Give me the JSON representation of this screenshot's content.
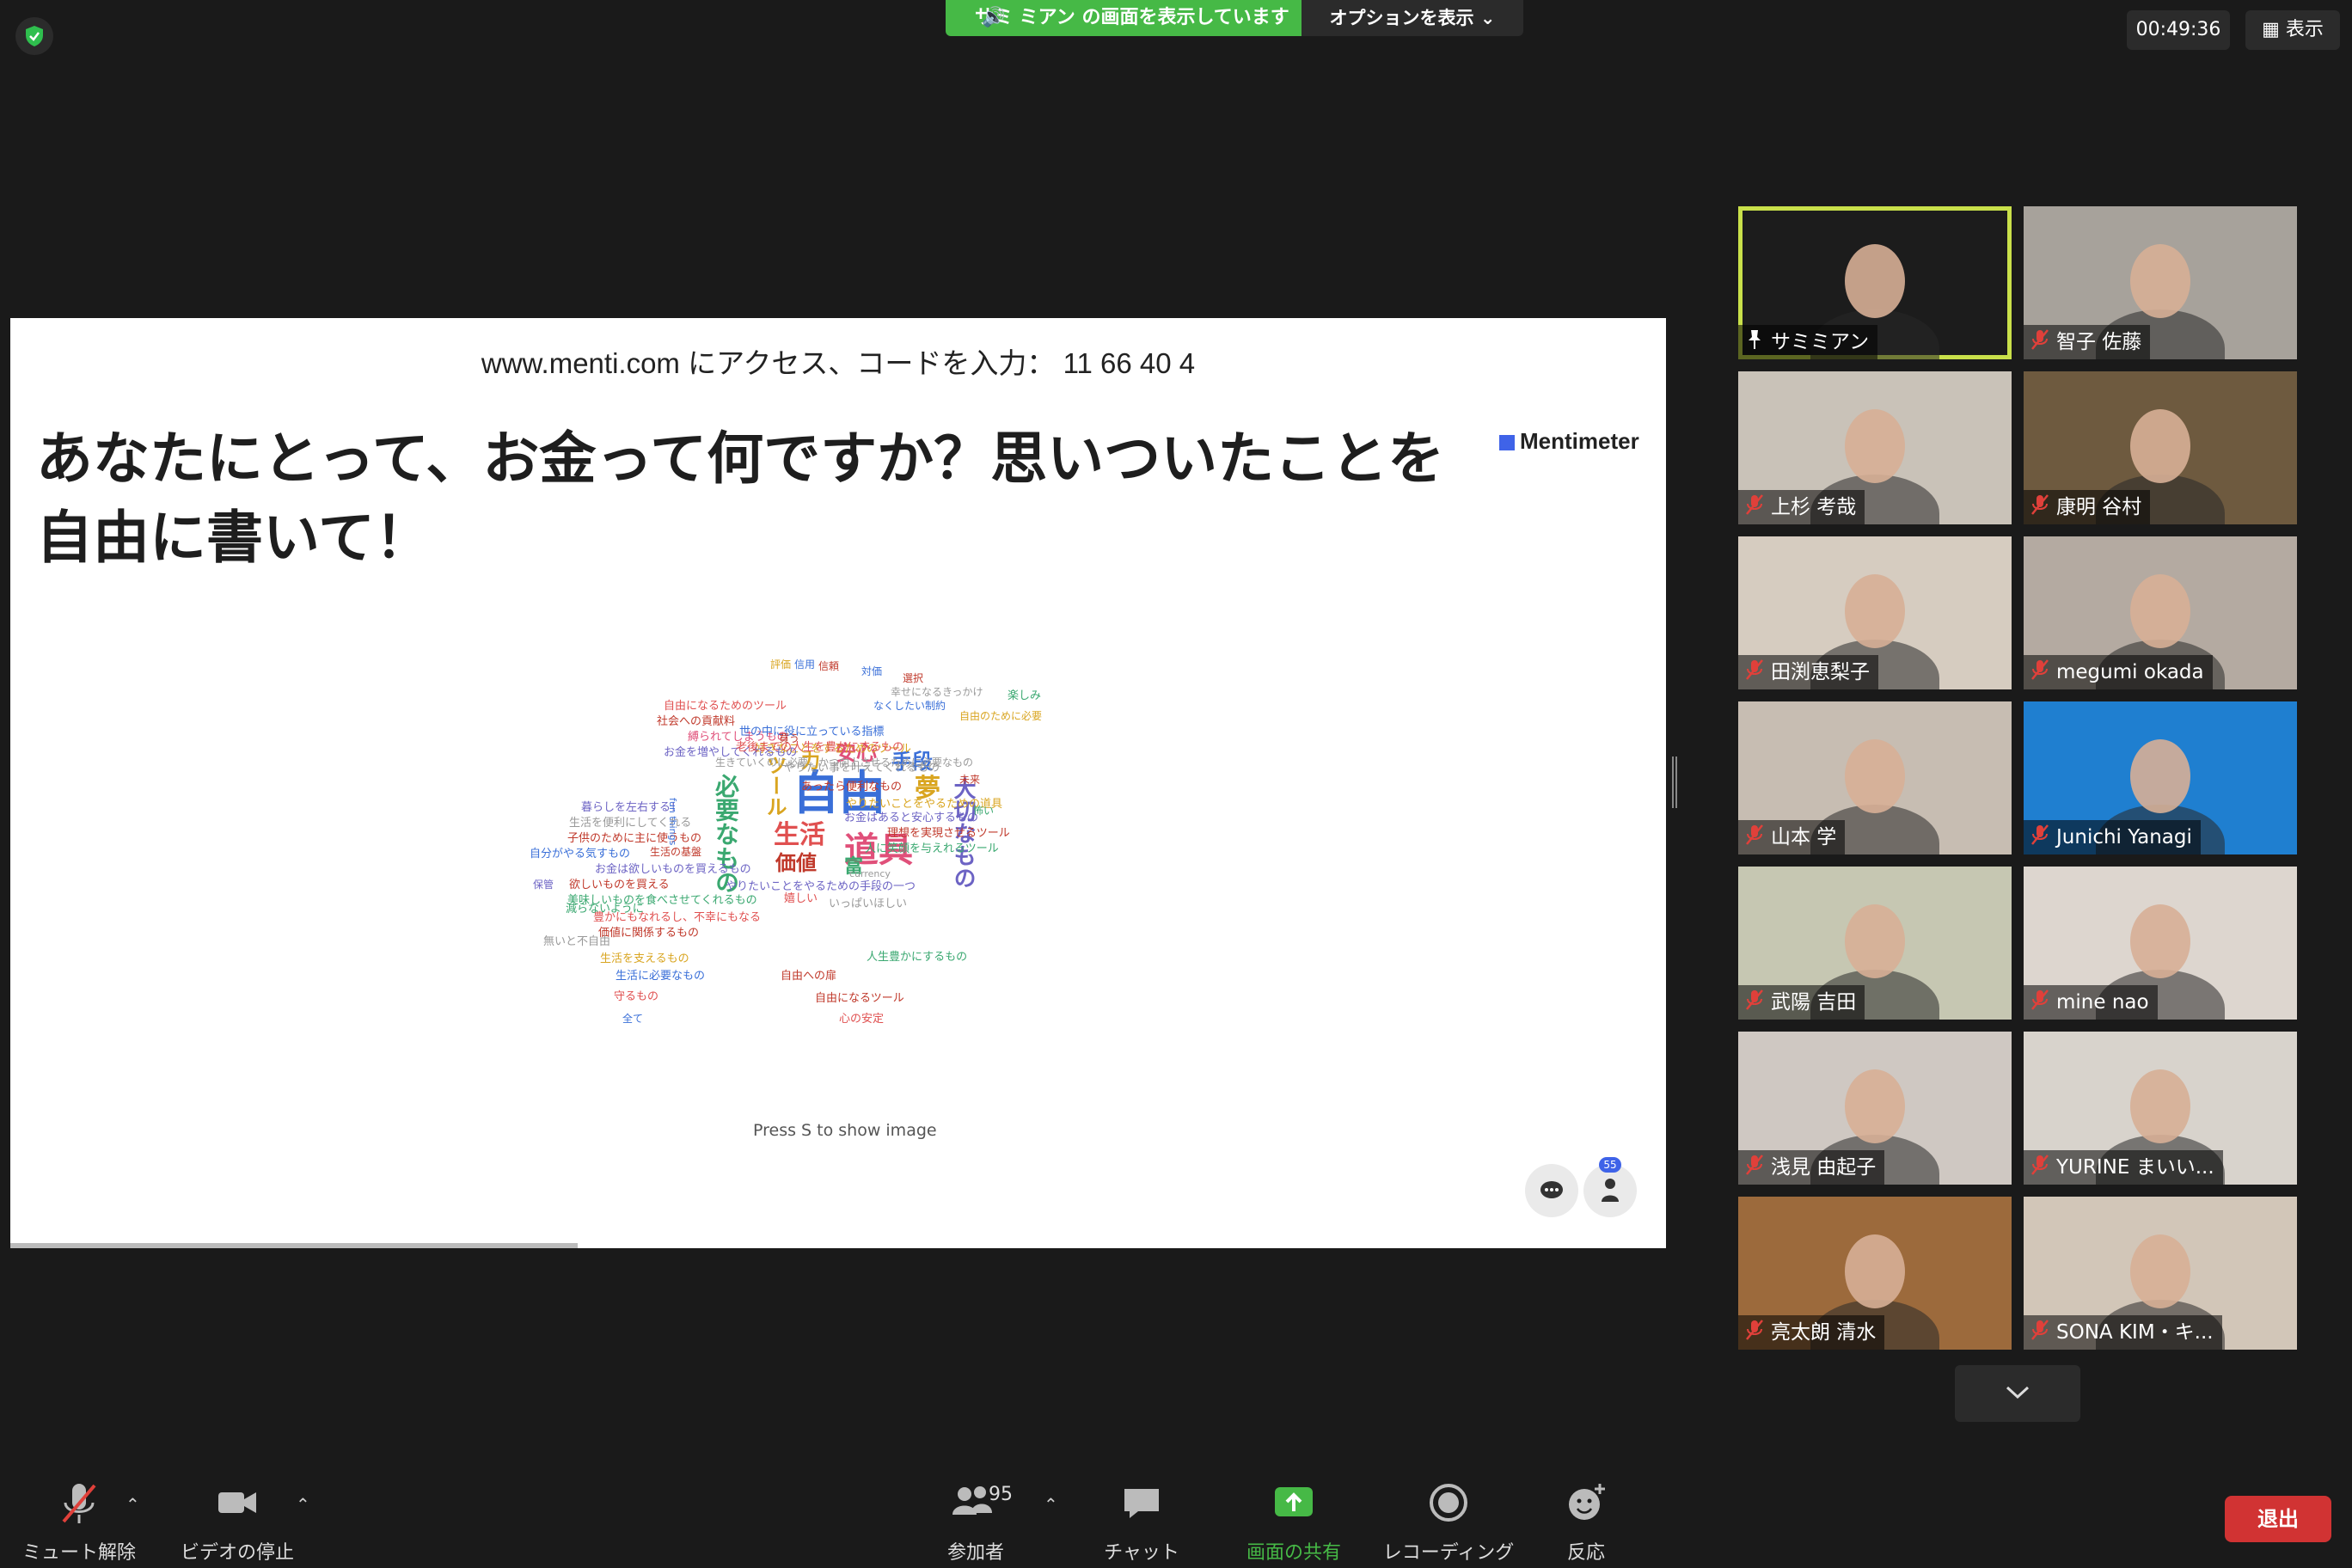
{
  "topbar": {
    "share_banner": "サミ ミアン の画面を表示しています",
    "options_label": "オプションを表示",
    "timer": "00:49:36",
    "view_label": "表示"
  },
  "slide": {
    "join_instructions": "www.menti.com にアクセス、コードを入力： 11 66 40 4",
    "question": "あなたにとって、お金って何ですか？思いついたことを自由に書いて！",
    "brand": "Mentimeter",
    "press_hint": "Press S to show image",
    "participant_count": "55",
    "wordcloud": [
      {
        "text": "自由",
        "size": 54,
        "color": "#3a6fd8"
      },
      {
        "text": "道具",
        "size": 40,
        "color": "#e0507a"
      },
      {
        "text": "生活",
        "size": 30,
        "color": "#e05050"
      },
      {
        "text": "夢",
        "size": 30,
        "color": "#d9a520"
      },
      {
        "text": "必要なもの",
        "size": 28,
        "color": "#3aa870"
      },
      {
        "text": "大切なもの",
        "size": 26,
        "color": "#6c63c4"
      },
      {
        "text": "ツール",
        "size": 24,
        "color": "#d9a520"
      },
      {
        "text": "安心",
        "size": 24,
        "color": "#e0507a"
      },
      {
        "text": "手段",
        "size": 24,
        "color": "#3a6fd8"
      },
      {
        "text": "価値",
        "size": 24,
        "color": "#c0392b"
      },
      {
        "text": "力",
        "size": 22,
        "color": "#d9a520"
      },
      {
        "text": "富",
        "size": 22,
        "color": "#3aa870"
      },
      {
        "text": "自由になるためのツール",
        "size": 13,
        "color": "#e05050"
      },
      {
        "text": "社会への貢献料",
        "size": 13,
        "color": "#c0392b"
      },
      {
        "text": "縛られてしまうもの",
        "size": 13,
        "color": "#e0507a"
      },
      {
        "text": "世の中に役に立っている指標",
        "size": 13,
        "color": "#3a6fd8"
      },
      {
        "text": "好きなことをするためのツール",
        "size": 13,
        "color": "#d9a520"
      },
      {
        "text": "お金を増やしてくれるもの",
        "size": 13,
        "color": "#6c63c4"
      },
      {
        "text": "生きていくのに必要、かつ向上させるために必要なもの",
        "size": 12,
        "color": "#999999"
      },
      {
        "text": "老後までの人生を豊かにするもの",
        "size": 13,
        "color": "#e05050"
      },
      {
        "text": "やりたい事を叶えてくれるもの",
        "size": 13,
        "color": "#999999"
      },
      {
        "text": "あったら便利なもの",
        "size": 13,
        "color": "#c0392b"
      },
      {
        "text": "やりたいことをやるための道具",
        "size": 13,
        "color": "#d9a520"
      },
      {
        "text": "お金はあると安心するもの",
        "size": 13,
        "color": "#6c63c4"
      },
      {
        "text": "理想を実現させるツール",
        "size": 13,
        "color": "#c0392b"
      },
      {
        "text": "人に笑顔を与えれるツール",
        "size": 13,
        "color": "#3aa870"
      },
      {
        "text": "暮らしを左右する！",
        "size": 13,
        "color": "#6c63c4"
      },
      {
        "text": "生活を便利にしてくれる",
        "size": 13,
        "color": "#999999"
      },
      {
        "text": "子供のために主に使うもの",
        "size": 13,
        "color": "#c0392b"
      },
      {
        "text": "自分がやる気すもの",
        "size": 13,
        "color": "#3a6fd8"
      },
      {
        "text": "お金は欲しいものを買えるもの",
        "size": 13,
        "color": "#6c63c4"
      },
      {
        "text": "欲しいものを買える",
        "size": 13,
        "color": "#c0392b"
      },
      {
        "text": "美味しいものを食べさせてくれるもの",
        "size": 13,
        "color": "#3aa870"
      },
      {
        "text": "やりたいことをやるための手段の一つ",
        "size": 13,
        "color": "#6c63c4"
      },
      {
        "text": "豊かにもなれるし、不幸にもなる",
        "size": 13,
        "color": "#e05050"
      },
      {
        "text": "価値に関係するもの",
        "size": 13,
        "color": "#c0392b"
      },
      {
        "text": "減らないように",
        "size": 13,
        "color": "#3aa870"
      },
      {
        "text": "無いと不自由",
        "size": 13,
        "color": "#999999"
      },
      {
        "text": "生活を支えるもの",
        "size": 13,
        "color": "#d9a520"
      },
      {
        "text": "生活に必要なもの",
        "size": 13,
        "color": "#3a6fd8"
      },
      {
        "text": "自由への扉",
        "size": 13,
        "color": "#c0392b"
      },
      {
        "text": "自由になるツール",
        "size": 13,
        "color": "#c0392b"
      },
      {
        "text": "人生豊かにするもの",
        "size": 13,
        "color": "#3aa870"
      },
      {
        "text": "心の安定",
        "size": 13,
        "color": "#e05050"
      },
      {
        "text": "守るもの",
        "size": 13,
        "color": "#e05050"
      },
      {
        "text": "いっぱいほしい",
        "size": 13,
        "color": "#999999"
      },
      {
        "text": "嬉しい",
        "size": 13,
        "color": "#e05050"
      },
      {
        "text": "currency",
        "size": 11,
        "color": "#999999"
      },
      {
        "text": "楽しみ",
        "size": 13,
        "color": "#3aa870"
      },
      {
        "text": "評価",
        "size": 12,
        "color": "#d9a520"
      },
      {
        "text": "信用",
        "size": 12,
        "color": "#3a6fd8"
      },
      {
        "text": "信頼",
        "size": 12,
        "color": "#c0392b"
      },
      {
        "text": "対価",
        "size": 12,
        "color": "#3a6fd8"
      },
      {
        "text": "選択",
        "size": 12,
        "color": "#c0392b"
      },
      {
        "text": "全て",
        "size": 12,
        "color": "#3a6fd8"
      },
      {
        "text": "保管",
        "size": 12,
        "color": "#6c63c4"
      },
      {
        "text": "未来",
        "size": 12,
        "color": "#c0392b"
      },
      {
        "text": "怖い",
        "size": 12,
        "color": "#3aa870"
      },
      {
        "text": "買う",
        "size": 12,
        "color": "#c0392b"
      },
      {
        "text": "なくしたい制約",
        "size": 12,
        "color": "#3a6fd8"
      },
      {
        "text": "幸せになるきっかけ",
        "size": 12,
        "color": "#999999"
      },
      {
        "text": "自由のために必要",
        "size": 12,
        "color": "#d9a520"
      },
      {
        "text": "生活の基盤",
        "size": 12,
        "color": "#c0392b"
      },
      {
        "text": "fun things",
        "size": 11,
        "color": "#3a6fd8"
      }
    ]
  },
  "participants": [
    {
      "name": "サミミアン",
      "active": true,
      "muted": false,
      "bg": "#1c1c1c"
    },
    {
      "name": "智子 佐藤",
      "active": false,
      "muted": true,
      "bg": "#a7a29b"
    },
    {
      "name": "上杉 考哉",
      "active": false,
      "muted": true,
      "bg": "#c9c2b8"
    },
    {
      "name": "康明 谷村",
      "active": false,
      "muted": true,
      "bg": "#6e5a3f"
    },
    {
      "name": "田渕恵梨子",
      "active": false,
      "muted": true,
      "bg": "#d6ccc0"
    },
    {
      "name": "megumi okada",
      "active": false,
      "muted": true,
      "bg": "#b4aaa1"
    },
    {
      "name": "山本 学",
      "active": false,
      "muted": true,
      "bg": "#c7bdb2"
    },
    {
      "name": "Junichi Yanagi",
      "active": false,
      "muted": true,
      "bg": "#1f7fd0"
    },
    {
      "name": "武陽 吉田",
      "active": false,
      "muted": true,
      "bg": "#c6c7b2"
    },
    {
      "name": "mine nao",
      "active": false,
      "muted": true,
      "bg": "#ddd6cf"
    },
    {
      "name": "浅見 由起子",
      "active": false,
      "muted": true,
      "bg": "#cfc8c2"
    },
    {
      "name": "YURINE まいい...",
      "active": false,
      "muted": true,
      "bg": "#d8d3cc"
    },
    {
      "name": "亮太朗 清水",
      "active": false,
      "muted": true,
      "bg": "#9c6a3c"
    },
    {
      "name": "SONA KIM・キ...",
      "active": false,
      "muted": true,
      "bg": "#d2c6b8"
    }
  ],
  "toolbar": {
    "unmute": "ミュート解除",
    "stop_video": "ビデオの停止",
    "participants": "参加者",
    "participants_count": "95",
    "chat": "チャット",
    "share_screen": "画面の共有",
    "recording": "レコーディング",
    "reactions": "反応",
    "leave": "退出"
  },
  "colors": {
    "share_green": "#46b946",
    "active_speaker": "#c9e04a",
    "leave_red": "#d13333",
    "muted_red": "#e0403a"
  }
}
